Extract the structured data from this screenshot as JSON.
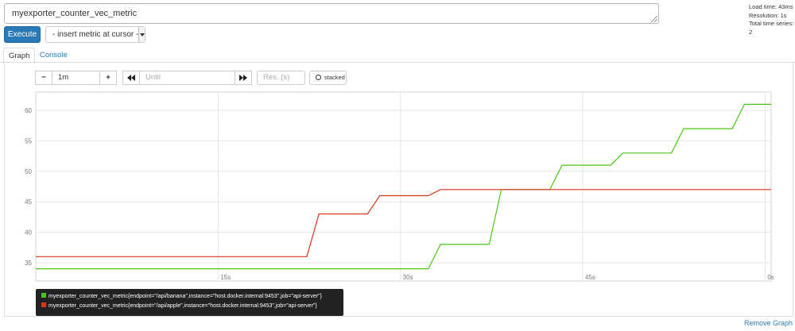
{
  "query": {
    "value": "myexporter_counter_vec_metric"
  },
  "stats": {
    "load_time": "Load time: 43ms",
    "resolution": "Resolution: 1s",
    "total_series": "Total time series: 2"
  },
  "toolbar": {
    "execute_label": "Execute",
    "metric_select_value": "- insert metric at cursor -"
  },
  "tabs": [
    {
      "label": "Graph",
      "active": true
    },
    {
      "label": "Console",
      "active": false
    }
  ],
  "graph_controls": {
    "range_minus": "−",
    "range_value": "1m",
    "range_plus": "+",
    "back_icon": "rewind-icon",
    "until_placeholder": "Until",
    "forward_icon": "fast-forward-icon",
    "resolution_placeholder": "Res. (s)",
    "stacked_label": "stacked"
  },
  "chart_data": {
    "type": "line",
    "x_tick_labels": [
      "15s",
      "30s",
      "45s",
      "0s"
    ],
    "x_ticks": [
      15,
      30,
      45,
      60
    ],
    "xlim": [
      0,
      60.5
    ],
    "ylim": [
      32,
      63
    ],
    "y_ticks": [
      35,
      40,
      45,
      50,
      55,
      60
    ],
    "grid": true,
    "series": [
      {
        "name": "myexporter_counter_vec_metric{endpoint=\"/api/banana\",instance=\"host.docker.internal:9453\",job=\"api-server\"}",
        "color": "#4cc417",
        "x": [
          0,
          32.3,
          33.3,
          37.3,
          38.3,
          42.3,
          43.3,
          47.3,
          48.3,
          52.3,
          53.3,
          57.3,
          58.3,
          60.5
        ],
        "y": [
          34,
          34,
          38,
          38,
          47,
          47,
          51,
          51,
          53,
          53,
          57,
          57,
          61,
          61
        ]
      },
      {
        "name": "myexporter_counter_vec_metric{endpoint=\"/api/apple\",instance=\"host.docker.internal:9453\",job=\"api-server\"}",
        "color": "#d9341c",
        "x": [
          0,
          22.3,
          23.3,
          27.3,
          28.3,
          32.3,
          33.3,
          60.5
        ],
        "y": [
          36,
          36,
          43,
          43,
          46,
          46,
          47,
          47
        ]
      }
    ]
  },
  "remove_graph": "Remove Graph"
}
